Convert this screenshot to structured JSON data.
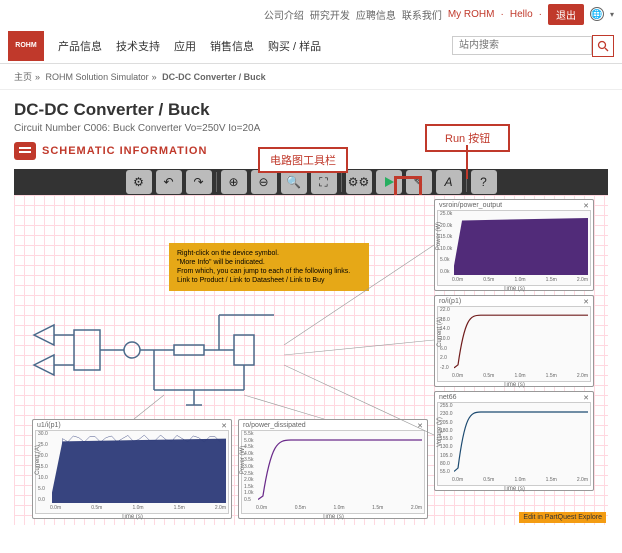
{
  "top_nav": {
    "links": [
      "公司介绍",
      "研究开发",
      "应聘信息",
      "联系我们",
      "My ROHM"
    ],
    "hello": "Hello",
    "logout": "退出"
  },
  "main_nav": {
    "logo": "ROHM",
    "items": [
      "产品信息",
      "技术支持",
      "应用",
      "销售信息",
      "购买 / 样品"
    ]
  },
  "search": {
    "placeholder": "站内搜索"
  },
  "breadcrumb": {
    "items": [
      "主页",
      "ROHM Solution Simulator",
      "DC-DC Converter / Buck"
    ]
  },
  "page": {
    "title": "DC-DC Converter / Buck",
    "subtitle": "Circuit Number C006: Buck Converter Vo=250V Io=20A",
    "schematic_link": "SCHEMATIC INFORMATION"
  },
  "annotations": {
    "toolbar_label": "电路图工具栏",
    "run_label": "Run 按钮"
  },
  "info_box": {
    "l1": "Right-click on the device symbol.",
    "l2": "\"More Info\" will be indicated.",
    "l3": "From which, you can jump to each of the following links.",
    "l4": "Link to Product  /  Link to Datasheet  /  Link to Buy"
  },
  "edit_badge": "Edit in PartQuest Explore",
  "chart_data": [
    {
      "id": "ch_power_out",
      "title": "vsroin/power_output",
      "type": "line",
      "ylabel": "Power (W)",
      "xlabel": "Time (s)",
      "ylim": [
        0,
        25
      ],
      "xlim": [
        0,
        2.0
      ],
      "yticks": [
        "25.0k",
        "20.0k",
        "15.0k",
        "10.0k",
        "5.0k",
        "0.0k"
      ],
      "xticks": [
        "0.0m",
        "0.5m",
        "1.0m",
        "1.5m",
        "2.0m"
      ],
      "fill": "#482072",
      "shape": "step-fill"
    },
    {
      "id": "ch_ro_ip1",
      "title": "ro/i(p1)",
      "type": "line",
      "ylabel": "Current (A)",
      "xlabel": "Time (s)",
      "ylim": [
        -2,
        22
      ],
      "xlim": [
        0,
        2.0
      ],
      "yticks": [
        "22.0",
        "18.0",
        "14.0",
        "10.0",
        "6.0",
        "2.0",
        "-2.0"
      ],
      "xticks": [
        "0.0m",
        "0.5m",
        "1.0m",
        "1.5m",
        "2.0m"
      ],
      "stroke": "#701c1c",
      "shape": "step"
    },
    {
      "id": "ch_net66",
      "title": "net66",
      "type": "line",
      "ylabel": "Voltage (V)",
      "xlabel": "Time (s)",
      "ylim": [
        0,
        260
      ],
      "xlim": [
        0,
        2.0
      ],
      "yticks": [
        "255.0",
        "230.0",
        "205.0",
        "180.0",
        "155.0",
        "130.0",
        "105.0",
        "80.0",
        "55.0"
      ],
      "xticks": [
        "0.0m",
        "0.5m",
        "1.0m",
        "1.5m",
        "2.0m"
      ],
      "stroke": "#1c4a70",
      "shape": "step"
    },
    {
      "id": "ch_u1_ip1",
      "title": "u1/i(p1)",
      "type": "line",
      "ylabel": "Current (A)",
      "xlabel": "Time (s)",
      "ylim": [
        0,
        30
      ],
      "xlim": [
        0,
        2.0
      ],
      "yticks": [
        "30.0",
        "25.0",
        "20.0",
        "15.0",
        "10.0",
        "5.0",
        "0.0"
      ],
      "xticks": [
        "0.0m",
        "0.5m",
        "1.0m",
        "1.5m",
        "2.0m"
      ],
      "fill": "#2c3a78",
      "shape": "noisy-fill"
    },
    {
      "id": "ch_ro_power",
      "title": "ro/power_dissipated",
      "type": "line",
      "ylabel": "Power (W)",
      "xlabel": "Time (s)",
      "ylim": [
        0,
        5.5
      ],
      "xlim": [
        0,
        2.0
      ],
      "yticks": [
        "5.5k",
        "5.0k",
        "4.5k",
        "4.0k",
        "3.5k",
        "3.0k",
        "2.5k",
        "2.0k",
        "1.5k",
        "1.0k",
        "0.5"
      ],
      "xticks": [
        "0.0m",
        "0.5m",
        "1.0m",
        "1.5m",
        "2.0m"
      ],
      "stroke": "#6a2a8a",
      "shape": "step"
    }
  ]
}
